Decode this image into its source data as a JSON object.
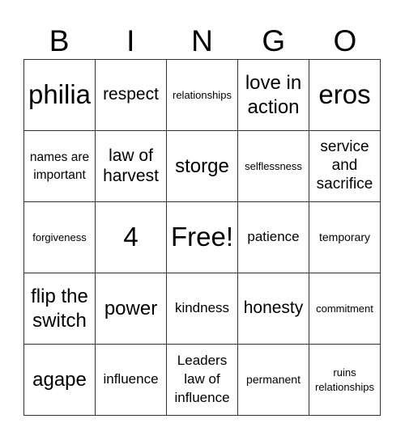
{
  "header": {
    "letters": [
      "B",
      "I",
      "N",
      "G",
      "O"
    ]
  },
  "card": {
    "rows": [
      [
        "philia",
        "respect",
        "relationships",
        "love in action",
        "eros"
      ],
      [
        "names are important",
        "law of harvest",
        "storge",
        "selflessness",
        "service and sacrifice"
      ],
      [
        "forgiveness",
        "4",
        "Free!",
        "patience",
        "temporary"
      ],
      [
        "flip the switch",
        "power",
        "kindness",
        "honesty",
        "commitment"
      ],
      [
        "agape",
        "influence",
        "Leaders law of influence",
        "permanent",
        "ruins relationships"
      ]
    ],
    "free_space": "Free!"
  }
}
